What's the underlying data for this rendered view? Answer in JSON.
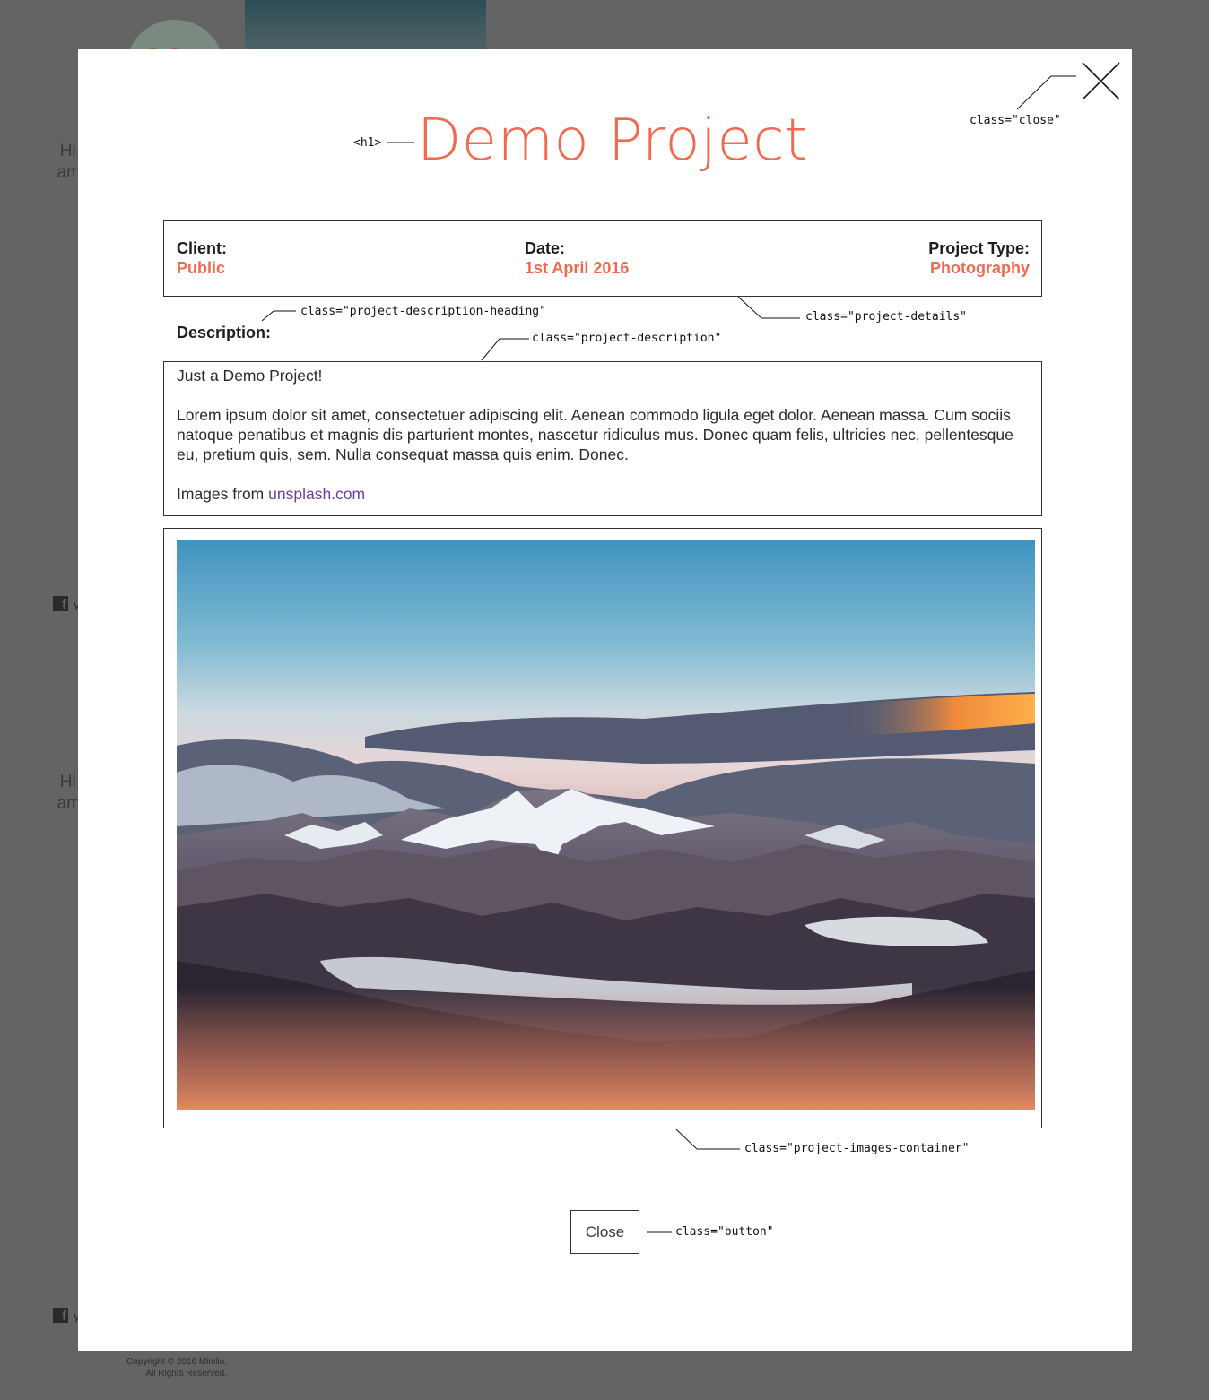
{
  "background": {
    "greeting_1": "Hi,",
    "greeting_1b": "am",
    "greeting_2": "Hi,",
    "greeting_2b": "am",
    "footer_line1": "Copyright © 2016 Minilio.",
    "footer_line2": "All Rights Reserved."
  },
  "modal": {
    "title": "Demo Project",
    "details": {
      "client_label": "Client:",
      "client_value": "Public",
      "date_label": "Date:",
      "date_value": "1st April 2016",
      "type_label": "Project Type:",
      "type_value": "Photography"
    },
    "description_heading": "Description:",
    "description": {
      "intro": "Just a Demo Project!",
      "body": "Lorem ipsum dolor sit amet, consectetuer adipiscing elit. Aenean commodo ligula eget dolor. Aenean massa. Cum sociis natoque penatibus et magnis dis parturient montes, nascetur ridiculus mus. Donec quam felis, ultricies nec, pellentesque eu, pretium quis, sem. Nulla consequat massa quis enim. Donec.",
      "credit_prefix": "Images from ",
      "credit_link": "unsplash.com"
    },
    "close_button": "Close"
  },
  "annotations": {
    "h1": "<h1>",
    "close": "class=\"close\"",
    "details": "class=\"project-details\"",
    "description_heading": "class=\"project-description-heading\"",
    "description": "class=\"project-description\"",
    "images": "class=\"project-images-container\"",
    "button": "class=\"button\""
  },
  "colors": {
    "accent": "#f06a50",
    "link": "#6a3fa0",
    "overlay": "#646464"
  },
  "icons": {
    "close": "close-icon",
    "facebook": "facebook-icon",
    "twitter": "twitter-icon"
  }
}
